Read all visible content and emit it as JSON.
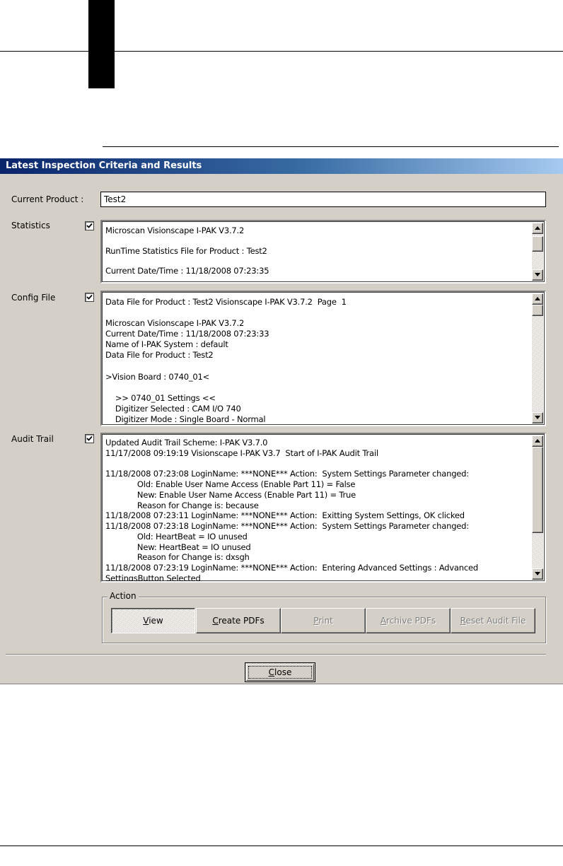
{
  "dialog": {
    "title": "Latest Inspection Criteria and Results",
    "current_product": {
      "label": "Current Product :",
      "value": "Test2"
    },
    "statistics": {
      "label": "Statistics",
      "checked": true,
      "text": "Microscan Visionscape I-PAK V3.7.2\n\nRunTime Statistics File for Product : Test2\n\nCurrent Date/Time : 11/18/2008 07:23:35"
    },
    "config_file": {
      "label": "Config File",
      "checked": true,
      "text": "Data File for Product : Test2 Visionscape I-PAK V3.7.2  Page  1\n\nMicroscan Visionscape I-PAK V3.7.2\nCurrent Date/Time : 11/18/2008 07:23:33\nName of I-PAK System : default\nData File for Product : Test2\n\n>Vision Board : 0740_01<\n\n    >> 0740_01 Settings <<\n    Digitizer Selected : CAM I/O 740\n    Digitizer Mode : Single Board - Normal\n    Camera Definitions And Buffer Counts :"
    },
    "audit_trail": {
      "label": "Audit Trail",
      "checked": true,
      "text": "Updated Audit Trail Scheme: I-PAK V3.7.0\n11/17/2008 09:19:19 Visionscape I-PAK V3.7  Start of I-PAK Audit Trail\n\n11/18/2008 07:23:08 LoginName: ***NONE*** Action:  System Settings Parameter changed:\n             Old: Enable User Name Access (Enable Part 11) = False\n             New: Enable User Name Access (Enable Part 11) = True\n             Reason for Change is: because\n11/18/2008 07:23:11 LoginName: ***NONE*** Action:  Exitting System Settings, OK clicked\n11/18/2008 07:23:18 LoginName: ***NONE*** Action:  System Settings Parameter changed:\n             Old: HeartBeat = IO unused\n             New: HeartBeat = IO unused\n             Reason for Change is: dxsgh\n11/18/2008 07:23:19 LoginName: ***NONE*** Action:  Entering Advanced Settings : Advanced\nSettingsButton Selected"
    },
    "action_group": {
      "label": "Action",
      "buttons": [
        {
          "u": "V",
          "rest": "iew"
        },
        {
          "u": "C",
          "rest": "reate PDFs"
        },
        {
          "u": "P",
          "rest": "rint"
        },
        {
          "u": "A",
          "rest": "rchive PDFs"
        },
        {
          "u": "R",
          "rest": "eset Audit File"
        }
      ]
    },
    "close": {
      "u": "C",
      "rest": "lose"
    }
  }
}
